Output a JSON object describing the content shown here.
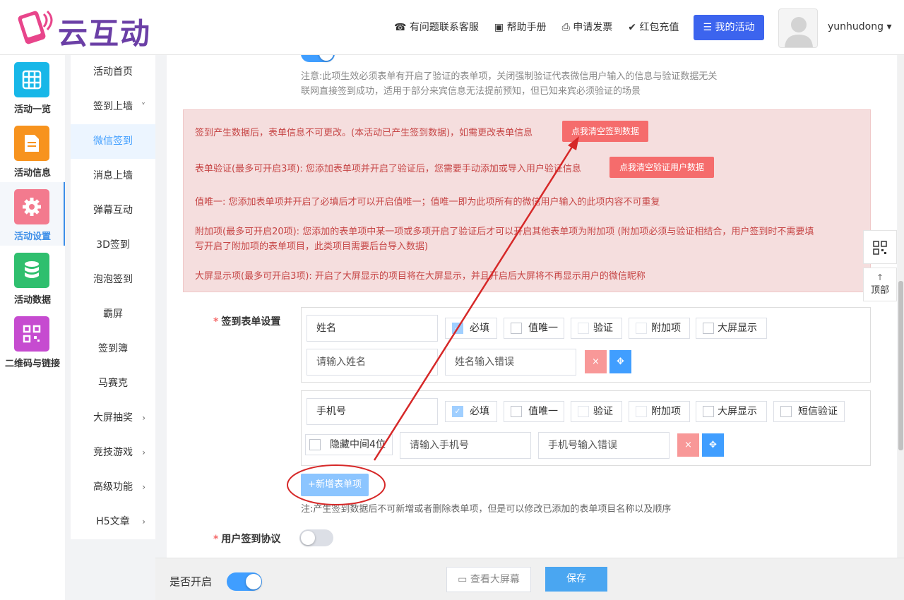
{
  "brand": {
    "logo_text": "云互动"
  },
  "header": {
    "links": [
      {
        "icon": "headset-icon",
        "glyph": "☎",
        "label": "有问题联系客服"
      },
      {
        "icon": "book-icon",
        "glyph": "▣",
        "label": "帮助手册"
      },
      {
        "icon": "printer-icon",
        "glyph": "⎙",
        "label": "申请发票"
      },
      {
        "icon": "shield-check-icon",
        "glyph": "✔",
        "label": "红包充值"
      }
    ],
    "my_activity": "☰ 我的活动",
    "username": "yunhudong"
  },
  "left_nav": [
    {
      "label": "活动一览",
      "color": "#17b7e8",
      "icon": "grid-icon",
      "glyph": "▦"
    },
    {
      "label": "活动信息",
      "color": "#f7931e",
      "icon": "document-icon",
      "glyph": "▤"
    },
    {
      "label": "活动设置",
      "color": "#f37a8e",
      "icon": "gear-icon",
      "glyph": "⚙",
      "active": true
    },
    {
      "label": "活动数据",
      "color": "#2fbf6e",
      "icon": "database-icon",
      "glyph": "◉"
    },
    {
      "label": "二维码与链接",
      "color": "#c64bd0",
      "icon": "qrcode-icon",
      "glyph": "▩"
    }
  ],
  "sub_nav": [
    {
      "label": "活动首页",
      "caret": ""
    },
    {
      "label": "签到上墙",
      "caret": "˅"
    },
    {
      "label": "微信签到",
      "caret": "",
      "active": true
    },
    {
      "label": "消息上墙",
      "caret": ""
    },
    {
      "label": "弹幕互动",
      "caret": ""
    },
    {
      "label": "3D签到",
      "caret": ""
    },
    {
      "label": "泡泡签到",
      "caret": ""
    },
    {
      "label": "霸屏",
      "caret": ""
    },
    {
      "label": "签到簿",
      "caret": ""
    },
    {
      "label": "马赛克",
      "caret": ""
    },
    {
      "label": "大屏抽奖",
      "caret": "›"
    },
    {
      "label": "竞技游戏",
      "caret": "›"
    },
    {
      "label": "高级功能",
      "caret": "›"
    },
    {
      "label": "H5文章",
      "caret": "›"
    }
  ],
  "note": {
    "line1": "注意:此项生效必须表单有开启了验证的表单项，关闭强制验证代表微信用户输入的信息与验证数据无关",
    "line2": "联网直接签到成功，适用于部分来宾信息无法提前预知，但已知来宾必须验证的场景"
  },
  "warning": {
    "l1": "签到产生数据后，表单信息不可更改。(本活动已产生签到数据)，如需更改表单信息",
    "btn1": "点我清空签到数据",
    "l2": "表单验证(最多可开启3项): 您添加表单项并开启了验证后，您需要手动添加或导入用户验证信息",
    "btn2": "点我清空验证用户数据",
    "l3": "值唯一: 您添加表单项并开启了必填后才可以开启值唯一；值唯一即为此项所有的微信用户输入的此项内容不可重复",
    "l4a": "附加项(最多可开启20项): 您添加的表单项中某一项或多项开启了验证后才可以开启其他表单项为附加项 (附加项必须与验证相结合，用户签到时不需要填",
    "l4b": "写开启了附加项的表单项目，此类项目需要后台导入数据)",
    "l5": "大屏显示项(最多可开启3项): 开启了大屏显示的项目将在大屏显示，并且开启后大屏将不再显示用户的微信昵称"
  },
  "form": {
    "label": "签到表单设置",
    "item1": {
      "name": "姓名",
      "required": "必填",
      "unique": "值唯一",
      "verify": "验证",
      "extra": "附加项",
      "bigscreen": "大屏显示",
      "placeholder": "请输入姓名",
      "error": "姓名输入错误"
    },
    "item2": {
      "name": "手机号",
      "required": "必填",
      "unique": "值唯一",
      "verify": "验证",
      "extra": "附加项",
      "bigscreen": "大屏显示",
      "sms": "短信验证",
      "hide4": "隐藏中间4位",
      "placeholder": "请输入手机号",
      "error": "手机号输入错误"
    },
    "add_btn": "+新增表单项",
    "add_note": "注:产生签到数据后不可新增或者删除表单项，但是可以修改已添加的表单项目名称以及顺序",
    "agreement_label": "用户签到协议"
  },
  "float": {
    "qr": "",
    "top": "顶部"
  },
  "footer": {
    "enable_label": "是否开启",
    "view_screen": "查看大屏幕",
    "save": "保存"
  },
  "colors": {
    "accent": "#409eff",
    "danger": "#f56c6c",
    "annotation": "#d62828"
  }
}
